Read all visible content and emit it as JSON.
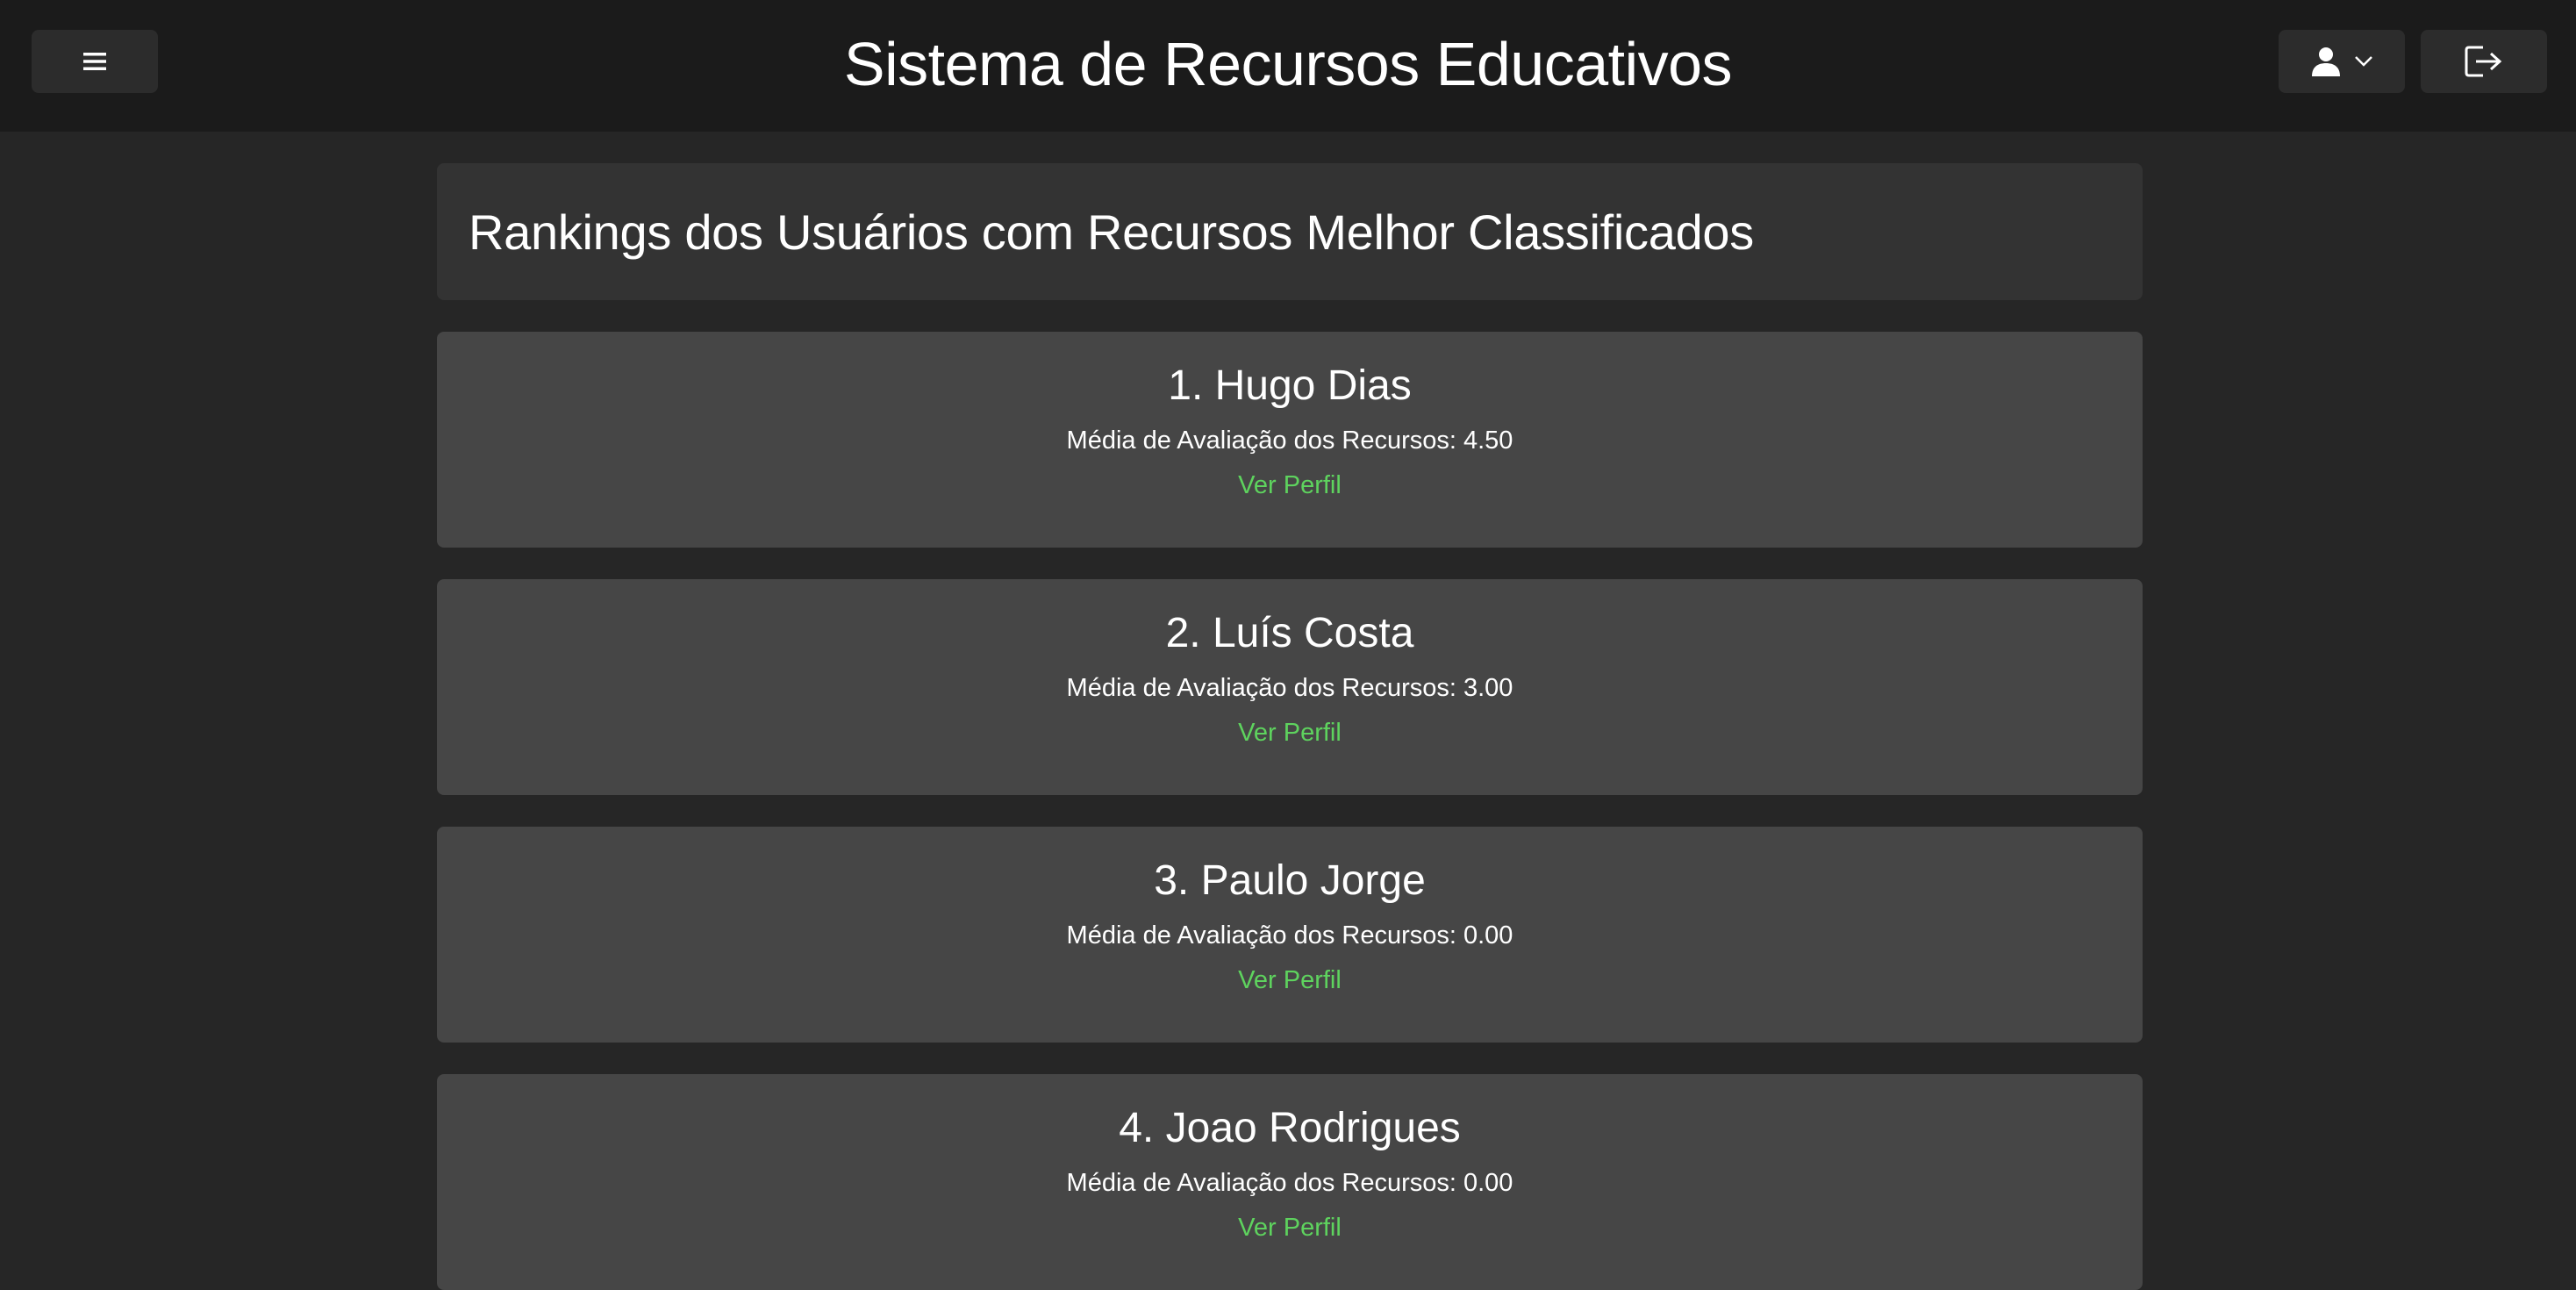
{
  "header": {
    "app_title": "Sistema de Recursos Educativos",
    "menu_icon": "hamburger-icon",
    "user_icon": "user-icon",
    "dropdown_icon": "chevron-down-icon",
    "logout_icon": "logout-icon"
  },
  "page": {
    "title": "Rankings dos Usuários com Recursos Melhor Classificados"
  },
  "rankings": [
    {
      "name": "1. Hugo Dias",
      "score": "Média de Avaliação dos Recursos: 4.50",
      "link": "Ver Perfil"
    },
    {
      "name": "2. Luís Costa",
      "score": "Média de Avaliação dos Recursos: 3.00",
      "link": "Ver Perfil"
    },
    {
      "name": "3. Paulo Jorge",
      "score": "Média de Avaliação dos Recursos: 0.00",
      "link": "Ver Perfil"
    },
    {
      "name": "4. Joao Rodrigues",
      "score": "Média de Avaliação dos Recursos: 0.00",
      "link": "Ver Perfil"
    }
  ],
  "colors": {
    "background": "#262626",
    "topbar": "#1b1b1b",
    "header_card": "#333333",
    "rank_card": "#464646",
    "link": "#5ed35e"
  }
}
